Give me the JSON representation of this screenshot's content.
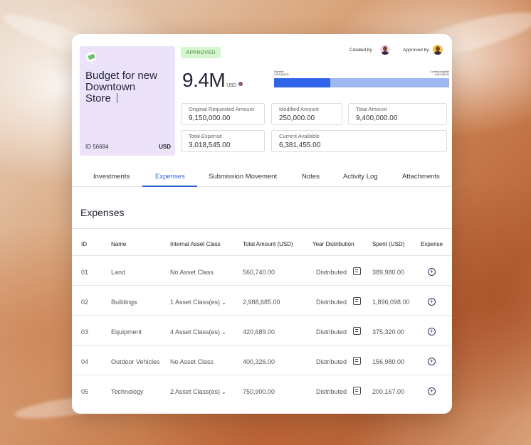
{
  "budget": {
    "title": "Budget for new Downtown Store",
    "id": "ID 56684",
    "currency": "USD"
  },
  "status_badge": "APPROVED",
  "created_by_label": "Created by",
  "approved_by_label": "Approved by",
  "amount": {
    "value": "9.4M",
    "unit": "USD"
  },
  "progress": {
    "expense_label": "Expense",
    "expense_value": "3,018,545.00",
    "available_label": "Current Available",
    "available_value": "6,381,455.00",
    "fraction": 0.32
  },
  "fields": {
    "original_requested": {
      "label": "Original Requested Amount",
      "value": "9,150,000.00"
    },
    "modified": {
      "label": "Modified Amount",
      "value": "250,000.00"
    },
    "total_amount": {
      "label": "Total Amount",
      "value": "9,400,000.00"
    },
    "total_expense": {
      "label": "Total Expense",
      "value": "3,018,545.00"
    },
    "current_available": {
      "label": "Current Available",
      "value": "6,381,455.00"
    }
  },
  "tabs": [
    "Investments",
    "Expenses",
    "Submission Movement",
    "Notes",
    "Activity Log",
    "Attachments"
  ],
  "active_tab": "Expenses",
  "section_title": "Expenses",
  "table": {
    "headers": [
      "ID",
      "Name",
      "Internal Asset Class",
      "Total Amount (USD)",
      "Year Distribution",
      "Spent (USD)",
      "Expense"
    ],
    "rows": [
      {
        "id": "01",
        "name": "Land",
        "asset_class": "No Asset Class",
        "total": "560,740.00",
        "distribution": "Distributed",
        "spent": "389,980.00"
      },
      {
        "id": "02",
        "name": "Buildings",
        "asset_class": "1 Asset Class(es)",
        "total": "2,988,685.00",
        "distribution": "Distributed",
        "spent": "1,896,098.00"
      },
      {
        "id": "03",
        "name": "Equipment",
        "asset_class": "4 Asset Class(es)",
        "total": "420,689.00",
        "distribution": "Distributed",
        "spent": "375,320.00"
      },
      {
        "id": "04",
        "name": "Outdoor Vehicles",
        "asset_class": "No Asset Class",
        "total": "400,326.00",
        "distribution": "Distributed",
        "spent": "156,980.00"
      },
      {
        "id": "05",
        "name": "Technology",
        "asset_class": "2 Asset Class(es)",
        "total": "750,900.00",
        "distribution": "Distributed",
        "spent": "200,167.00"
      }
    ]
  },
  "icons": {
    "budget": "money-icon",
    "distribution": "document-icon",
    "expense": "plus-circle-icon",
    "asset_dropdown": "chevron-down-icon"
  },
  "colors": {
    "accent": "#2d5fdc",
    "progress_fill": "#3164e8",
    "progress_track": "#9db8ef",
    "approved_bg": "#d6f5d0",
    "approved_text": "#3b8a33",
    "budget_card_bg": "#ece3fb"
  }
}
